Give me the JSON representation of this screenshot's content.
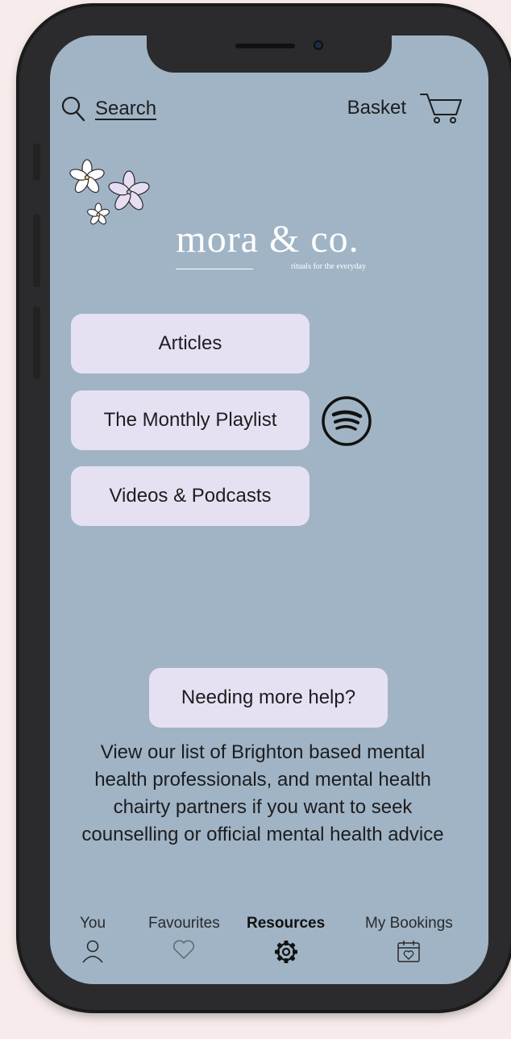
{
  "header": {
    "search_label": "Search",
    "basket_label": "Basket",
    "search_icon": "search-icon",
    "basket_icon": "cart-icon"
  },
  "brand": {
    "name": "mora & co.",
    "tagline": "rituals for the everyday"
  },
  "resources": {
    "buttons": [
      {
        "label": "Articles"
      },
      {
        "label": "The Monthly Playlist"
      },
      {
        "label": "Videos & Podcasts"
      }
    ],
    "playlist_icon": "spotify-icon"
  },
  "help": {
    "button_label": "Needing more help?",
    "description": "View our list of Brighton based mental health professionals, and mental health chairty partners if you want to seek counselling or official mental health advice"
  },
  "tabbar": {
    "items": [
      {
        "label": "You",
        "icon": "user-icon",
        "active": false
      },
      {
        "label": "Favourites",
        "icon": "heart-icon",
        "active": false
      },
      {
        "label": "Resources",
        "icon": "gear-icon",
        "active": true
      },
      {
        "label": "My Bookings",
        "icon": "calendar-icon",
        "active": false
      }
    ]
  },
  "colors": {
    "screen_bg": "#a0b4c5",
    "button_bg": "#e6e0f3",
    "text": "#1d1d1f"
  }
}
